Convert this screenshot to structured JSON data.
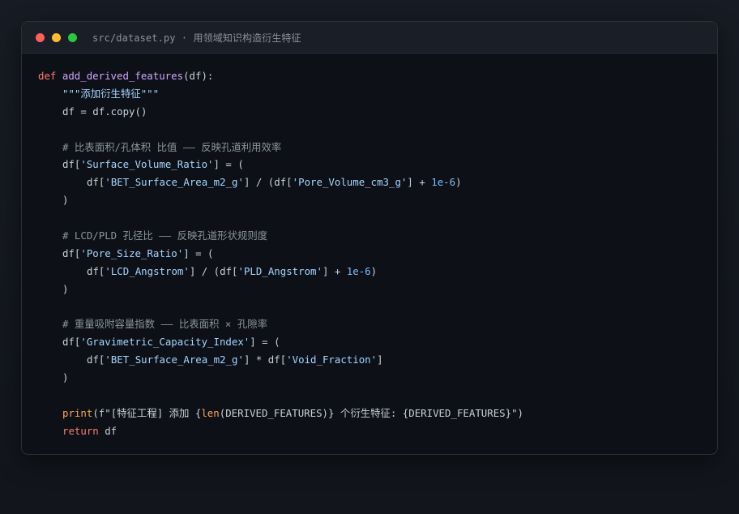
{
  "window": {
    "title": "src/dataset.py · 用领域知识构造衍生特征"
  },
  "code": {
    "lines": [
      [
        {
          "t": "def",
          "c": "kw"
        },
        {
          "t": " ",
          "c": "txt"
        },
        {
          "t": "add_derived_features",
          "c": "fn"
        },
        {
          "t": "(df):",
          "c": "txt"
        }
      ],
      [
        {
          "t": "\"\"\"添加衍生特征\"\"\"",
          "c": "str",
          "indent": 1
        }
      ],
      [
        {
          "t": "df = df.copy()",
          "c": "txt",
          "indent": 1
        }
      ],
      [],
      [
        {
          "t": "# 比表面积/孔体积 比值 —— 反映孔道利用效率",
          "c": "com",
          "indent": 1
        }
      ],
      [
        {
          "t": "df[",
          "c": "txt",
          "indent": 1
        },
        {
          "t": "'Surface_Volume_Ratio'",
          "c": "str"
        },
        {
          "t": "] = (",
          "c": "txt"
        }
      ],
      [
        {
          "t": "df[",
          "c": "txt",
          "indent": 2
        },
        {
          "t": "'BET_Surface_Area_m2_g'",
          "c": "str"
        },
        {
          "t": "] / (df[",
          "c": "txt"
        },
        {
          "t": "'Pore_Volume_cm3_g'",
          "c": "str"
        },
        {
          "t": "] + ",
          "c": "txt"
        },
        {
          "t": "1e-6",
          "c": "num"
        },
        {
          "t": ")",
          "c": "txt"
        }
      ],
      [
        {
          "t": ")",
          "c": "txt",
          "indent": 1
        }
      ],
      [],
      [
        {
          "t": "# LCD/PLD 孔径比 —— 反映孔道形状规则度",
          "c": "com",
          "indent": 1
        }
      ],
      [
        {
          "t": "df[",
          "c": "txt",
          "indent": 1
        },
        {
          "t": "'Pore_Size_Ratio'",
          "c": "str"
        },
        {
          "t": "] = (",
          "c": "txt"
        }
      ],
      [
        {
          "t": "df[",
          "c": "txt",
          "indent": 2
        },
        {
          "t": "'LCD_Angstrom'",
          "c": "str"
        },
        {
          "t": "] / (df[",
          "c": "txt"
        },
        {
          "t": "'PLD_Angstrom'",
          "c": "str"
        },
        {
          "t": "] + ",
          "c": "txt"
        },
        {
          "t": "1e-6",
          "c": "num"
        },
        {
          "t": ")",
          "c": "txt"
        }
      ],
      [
        {
          "t": ")",
          "c": "txt",
          "indent": 1
        }
      ],
      [],
      [
        {
          "t": "# 重量吸附容量指数 —— 比表面积 × 孔隙率",
          "c": "com",
          "indent": 1
        }
      ],
      [
        {
          "t": "df[",
          "c": "txt",
          "indent": 1
        },
        {
          "t": "'Gravimetric_Capacity_Index'",
          "c": "str"
        },
        {
          "t": "] = (",
          "c": "txt"
        }
      ],
      [
        {
          "t": "df[",
          "c": "txt",
          "indent": 2
        },
        {
          "t": "'BET_Surface_Area_m2_g'",
          "c": "str"
        },
        {
          "t": "] * df[",
          "c": "txt"
        },
        {
          "t": "'Void_Fraction'",
          "c": "str"
        },
        {
          "t": "]",
          "c": "txt"
        }
      ],
      [
        {
          "t": ")",
          "c": "txt",
          "indent": 1
        }
      ],
      [],
      [
        {
          "t": "print",
          "c": "bi",
          "indent": 1
        },
        {
          "t": "(f\"[特征工程] 添加 {",
          "c": "txt"
        },
        {
          "t": "len",
          "c": "bi"
        },
        {
          "t": "(DERIVED_FEATURES)} 个衍生特征: {DERIVED_FEATURES}\")",
          "c": "txt"
        }
      ],
      [
        {
          "t": "return",
          "c": "kw",
          "indent": 1
        },
        {
          "t": " df",
          "c": "txt"
        }
      ]
    ]
  },
  "colors": {
    "keyword": "#ff7b72",
    "function": "#d2a8ff",
    "string": "#a5d6ff",
    "number": "#79c0ff",
    "comment": "#8b949e",
    "builtin": "#ffa657",
    "text": "#c9d1d9",
    "dot_close": "#ff5f57",
    "dot_minimize": "#febc2e",
    "dot_zoom": "#28c840"
  }
}
